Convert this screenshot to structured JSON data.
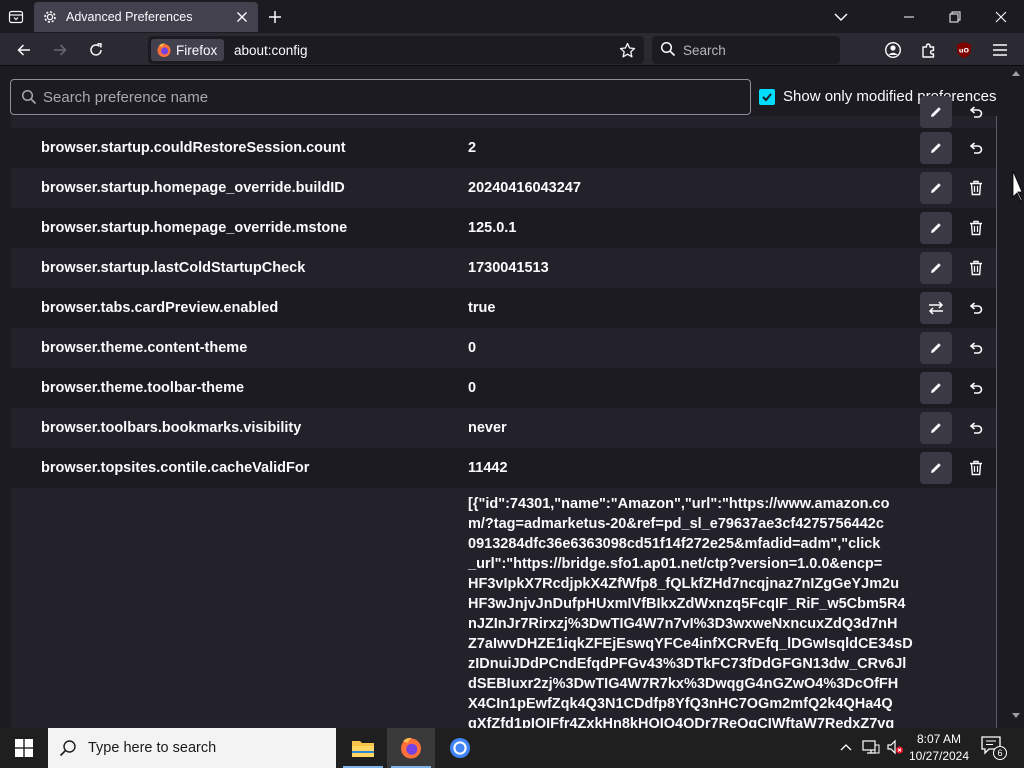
{
  "window": {
    "tab_title": "Advanced Preferences"
  },
  "navbar": {
    "identity_label": "Firefox",
    "url": "about:config",
    "search_placeholder": "Search"
  },
  "prefs_page": {
    "search_placeholder": "Search preference name",
    "show_modified_label": "Show only modified preferences",
    "show_modified_checked": true,
    "rows": [
      {
        "name": "browser.startup.couldRestoreSession.count",
        "value": "2",
        "edit": "pencil-icon",
        "action": "reset-icon"
      },
      {
        "name": "browser.startup.homepage_override.buildID",
        "value": "20240416043247",
        "edit": "pencil-icon",
        "action": "trash-icon"
      },
      {
        "name": "browser.startup.homepage_override.mstone",
        "value": "125.0.1",
        "edit": "pencil-icon",
        "action": "trash-icon"
      },
      {
        "name": "browser.startup.lastColdStartupCheck",
        "value": "1730041513",
        "edit": "pencil-icon",
        "action": "trash-icon"
      },
      {
        "name": "browser.tabs.cardPreview.enabled",
        "value": "true",
        "edit": "toggle-icon",
        "action": "reset-icon"
      },
      {
        "name": "browser.theme.content-theme",
        "value": "0",
        "edit": "pencil-icon",
        "action": "reset-icon"
      },
      {
        "name": "browser.theme.toolbar-theme",
        "value": "0",
        "edit": "pencil-icon",
        "action": "reset-icon"
      },
      {
        "name": "browser.toolbars.bookmarks.visibility",
        "value": "never",
        "edit": "pencil-icon",
        "action": "reset-icon"
      },
      {
        "name": "browser.topsites.contile.cacheValidFor",
        "value": "11442",
        "edit": "pencil-icon",
        "action": "trash-icon"
      }
    ],
    "json_value_lines": [
      "[{\"id\":74301,\"name\":\"Amazon\",\"url\":\"https://www.amazon.co",
      "m/?tag=admarketus-20&ref=pd_sl_e79637ae3cf4275756442c",
      "0913284dfc36e6363098cd51f14f272e25&mfadid=adm\",\"click",
      "_url\":\"https://bridge.sfo1.ap01.net/ctp?version=1.0.0&encp=",
      "HF3vIpkX7RcdjpkX4ZfWfp8_fQLkfZHd7ncqjnaz7nIZgGeYJm2u",
      "HF3wJnjvJnDufpHUxmIVfBIkxZdWxnzq5FcqIF_RiF_w5Cbm5R4",
      "nJZInJr7Rirxzj%3DwTIG4W7n7vI%3D3wxweNxncuxZdQ3d7nH",
      "Z7aIwvDHZE1iqkZFEjEswqYFCe4infXCRvEfq_lDGwIsqldCE34sD",
      "zIDnuiJDdPCndEfqdPFGv43%3DTkFC73fDdGFGN13dw_CRv6Jl",
      "dSEBIuxr2zj%3DwTIG4W7R7kx%3DwqgG4nGZwO4%3DcOfFH",
      "X4CIn1pEwfZqk4Q3N1CDdfp8YfQ3nHC7OGm2mfQ2k4QHa4Q",
      "qXfZfd1pIOIFfr4ZxkHn8kHOIO4QDr7ReOqCIWftaW7RedxZ7vq"
    ]
  },
  "taskbar": {
    "search_placeholder": "Type here to search",
    "time": "8:07 AM",
    "date": "10/27/2024",
    "notification_count": "6"
  },
  "colors": {
    "page_bg": "#1c1b22",
    "row_alt_bg": "#23222b",
    "checkbox_accent": "#00ddff",
    "toolbar_bg": "#2b2a33"
  }
}
